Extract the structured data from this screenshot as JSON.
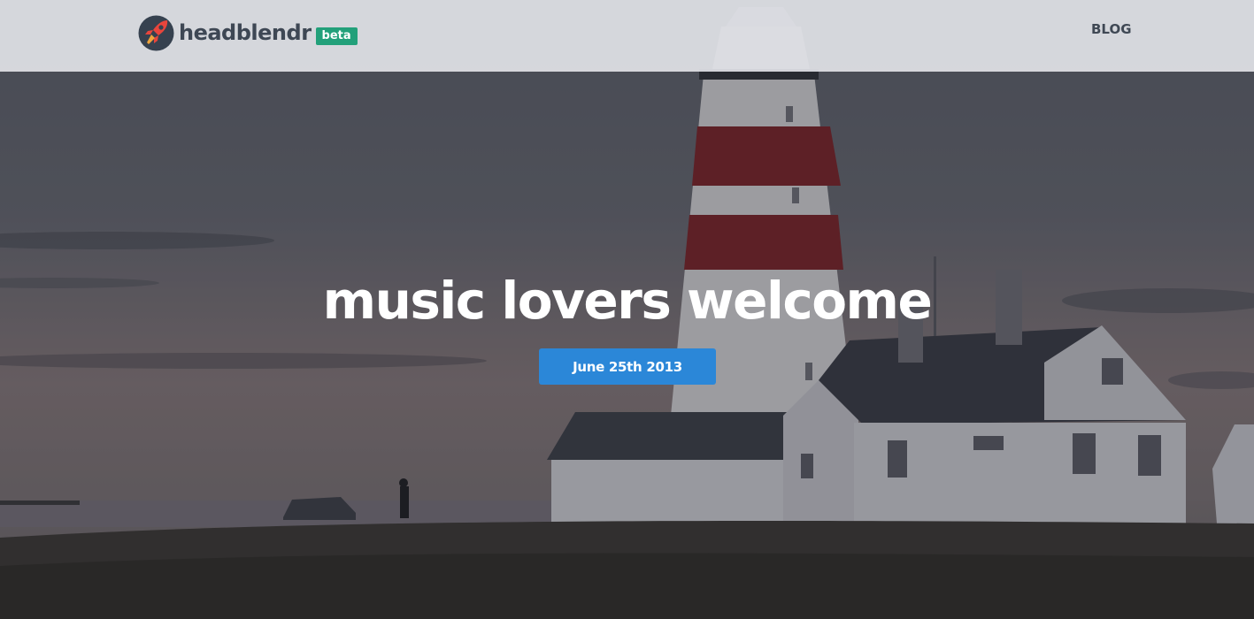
{
  "header": {
    "brand": "headblendr",
    "badge": "beta",
    "nav": {
      "blog_label": "BLOG"
    }
  },
  "hero": {
    "headline": "music lovers welcome",
    "date_button_label": "June 25th 2013"
  },
  "icons": {
    "logo": "rocket-icon"
  },
  "colors": {
    "header_bg": "#e2e3e8",
    "brand_text": "#3e4754",
    "badge_bg": "#22a07a",
    "button_bg": "#2b87d8",
    "headline": "#ffffff"
  }
}
